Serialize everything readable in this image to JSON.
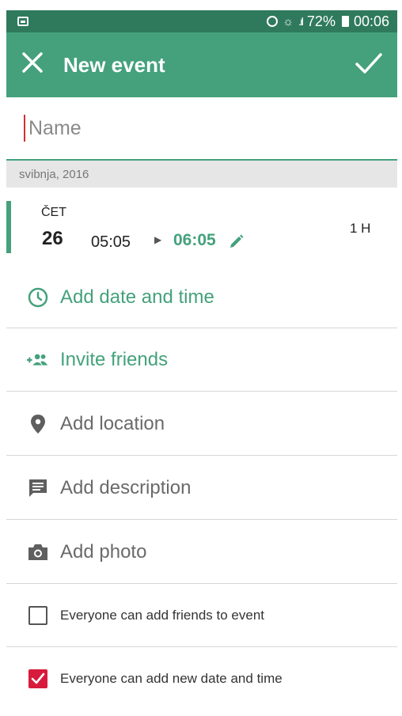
{
  "status_bar": {
    "battery": "72%",
    "time": "00:06"
  },
  "app_bar": {
    "title": "New event"
  },
  "name_field": {
    "placeholder": "Name"
  },
  "month_header": "svibnja, 2016",
  "event_time": {
    "day_of_week": "ČET",
    "day": "26",
    "start_time": "05:05",
    "end_time": "06:05",
    "duration": "1 H"
  },
  "actions": {
    "add_date_time": "Add date and time",
    "invite_friends": "Invite friends",
    "add_location": "Add location",
    "add_description": "Add description",
    "add_photo": "Add photo"
  },
  "options": {
    "friends_option": {
      "label": "Everyone can add friends to event",
      "checked": false
    },
    "datetime_option": {
      "label": "Everyone can add new date and time",
      "checked": true
    }
  },
  "colors": {
    "status_bar": "#2f7a5c",
    "app_bar": "#44a17c",
    "accent": "#44a17c",
    "checkbox_checked": "#d81b3c"
  },
  "icons": {
    "close": "close-icon",
    "confirm": "check-icon",
    "clock": "clock-icon",
    "invite": "add-people-icon",
    "location": "location-pin-icon",
    "description": "message-icon",
    "photo": "camera-icon",
    "edit": "pencil-icon"
  }
}
